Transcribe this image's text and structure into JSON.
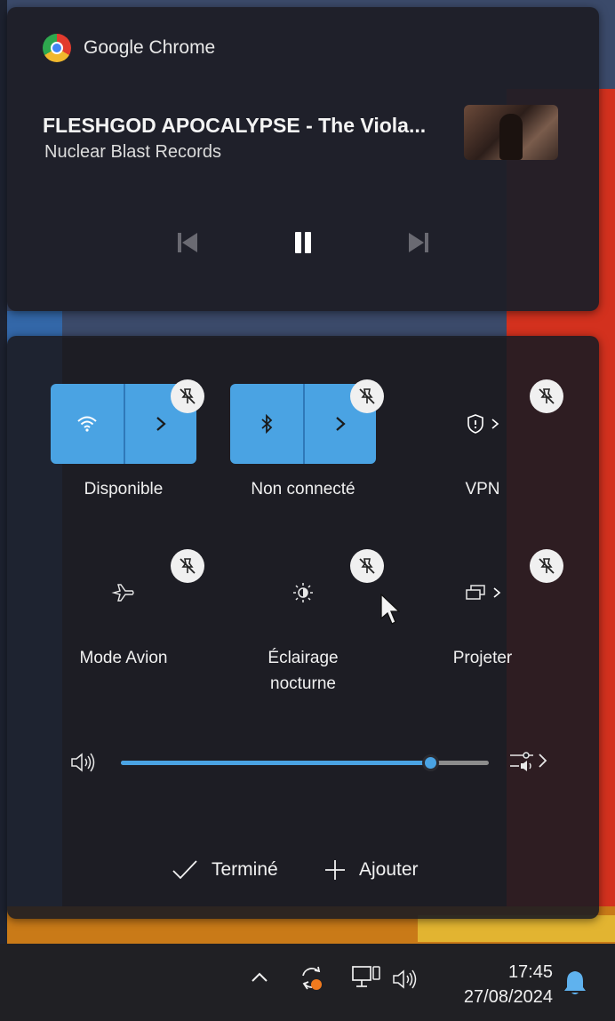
{
  "media": {
    "app_name": "Google Chrome",
    "title": "FLESHGOD APOCALYPSE - The Viola...",
    "artist": "Nuclear Blast Records",
    "icons": [
      "chrome-logo",
      "album-thumbnail",
      "previous-track-icon",
      "pause-icon",
      "next-track-icon"
    ]
  },
  "quick_settings": {
    "tiles": [
      {
        "label": "Disponible",
        "icon": "wifi-icon",
        "active": true
      },
      {
        "label": "Non connecté",
        "icon": "bluetooth-icon",
        "active": true
      },
      {
        "label": "VPN",
        "icon": "shield-icon",
        "active": false
      },
      {
        "label": "Mode Avion",
        "icon": "airplane-icon",
        "active": false
      },
      {
        "label_line1": "Éclairage",
        "label_line2": "nocturne",
        "icon": "brightness-icon",
        "active": false
      },
      {
        "label": "Projeter",
        "icon": "project-icon",
        "active": false
      }
    ],
    "volume": {
      "level": 0.84,
      "icon": "speaker-icon",
      "output_icon": "audio-output-icon"
    },
    "done_label": "Terminé",
    "add_label": "Ajouter"
  },
  "taskbar": {
    "time": "17:45",
    "date": "27/08/2024",
    "icons": [
      "chevron-up-icon",
      "sync-icon",
      "network-icon",
      "volume-icon",
      "notification-bell-icon"
    ]
  },
  "colors": {
    "accent": "#4aa3e3",
    "panel": "#1c1c22",
    "taskbar": "#202024"
  }
}
